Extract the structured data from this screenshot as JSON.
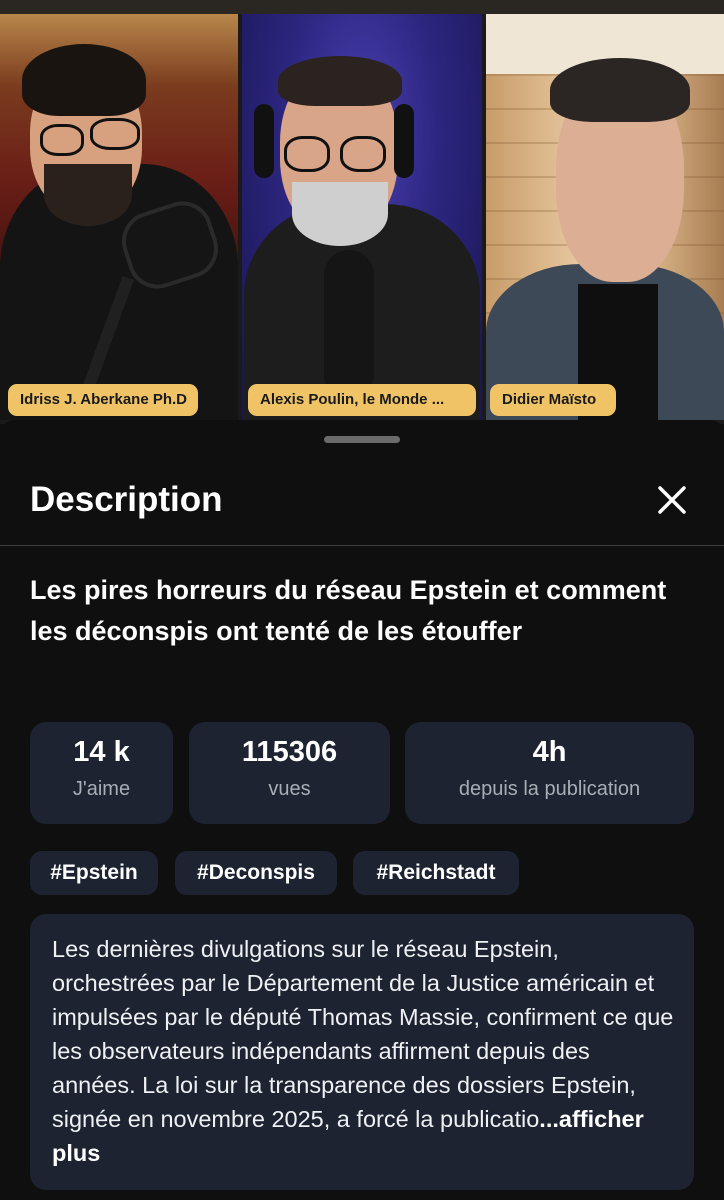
{
  "video": {
    "participants": [
      {
        "name": "Idriss J. Aberkane Ph.D"
      },
      {
        "name": "Alexis Poulin, le Monde ..."
      },
      {
        "name": "Didier Maïsto"
      }
    ]
  },
  "sheet": {
    "title": "Description",
    "close_icon": "close-icon",
    "video_title": "Les pires horreurs du réseau Epstein et comment les déconspis ont tenté de les étouffer",
    "stats": [
      {
        "value": "14 k",
        "label": "J'aime"
      },
      {
        "value": "115306",
        "label": "vues"
      },
      {
        "value": "4h",
        "label": "depuis la publication"
      }
    ],
    "tags": [
      "#Epstein",
      "#Deconspis",
      "#Reichstadt"
    ],
    "description": "Les dernières divulgations sur le réseau Epstein, orchestrées par le Département de la Justice américain et impulsées par le député Thomas Massie, confirment ce que les observateurs indépendants affirment depuis des années. La loi sur la transparence des dossiers Epstein, signée en novembre 2025, a forcé la publicatio",
    "more_label": "...afficher plus"
  },
  "colors": {
    "background": "#0f0f0f",
    "card": "#1d2330",
    "name_chip": "#f0c466",
    "muted_text": "#a9adb5"
  }
}
